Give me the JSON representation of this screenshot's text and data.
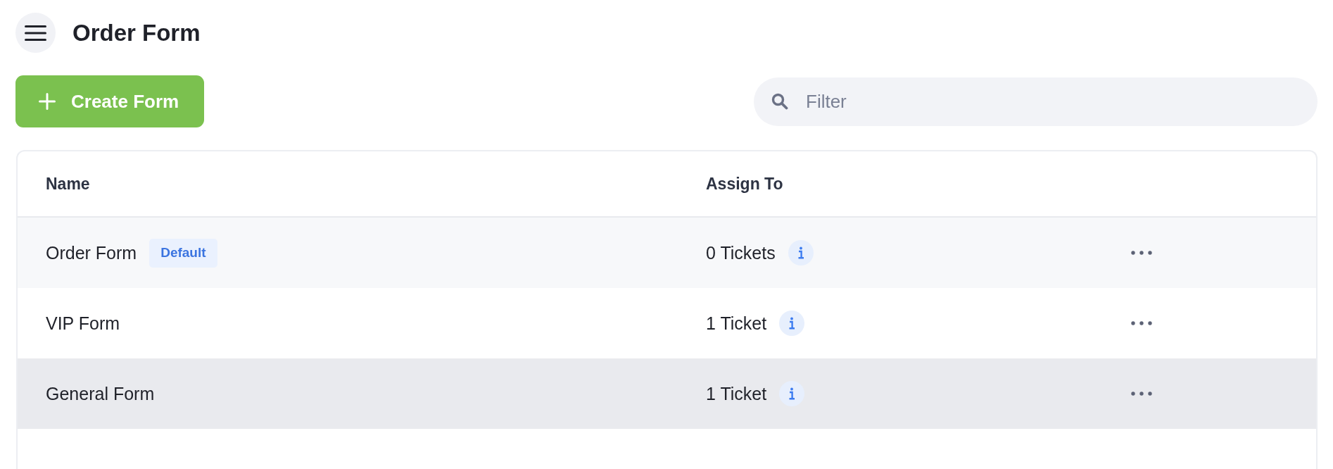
{
  "title": "Order Form",
  "toolbar": {
    "create_button": {
      "label": "Create Form"
    },
    "filter": {
      "placeholder": "Filter"
    }
  },
  "table": {
    "columns": [
      "Name",
      "Assign To"
    ],
    "rows": [
      {
        "name": "Order Form",
        "badge": "Default",
        "assigned": "0 Tickets",
        "selected": false
      },
      {
        "name": "VIP Form",
        "assigned": "1 Ticket",
        "selected": false
      },
      {
        "name": "General Form",
        "assigned": "1 Ticket",
        "selected": true
      }
    ]
  }
}
